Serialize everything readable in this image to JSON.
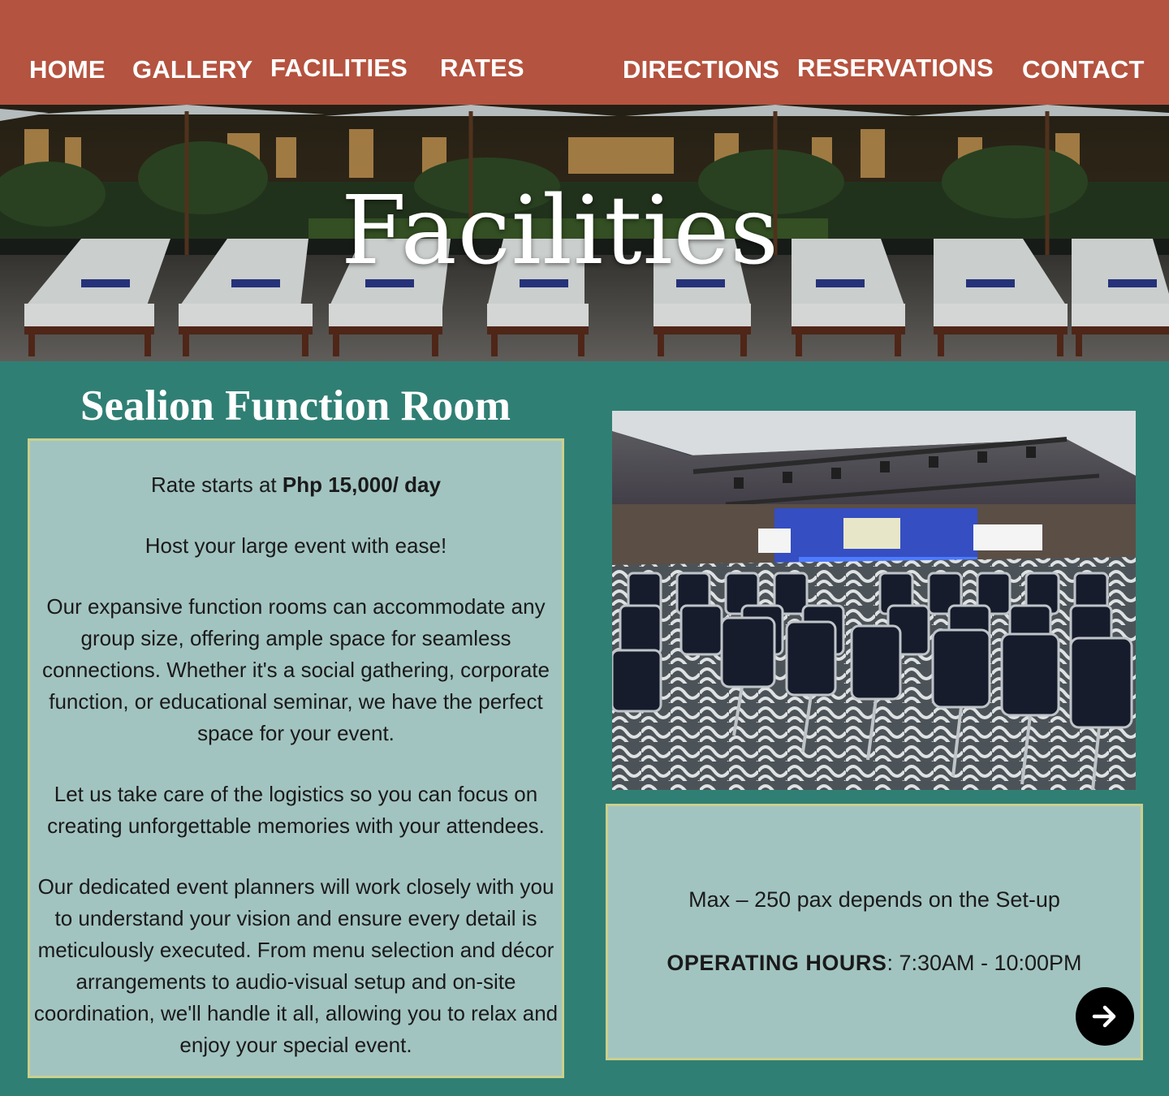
{
  "nav": {
    "items": [
      "HOME",
      "GALLERY",
      "FACILITIES",
      "RATES",
      "DIRECTIONS",
      "RESERVATIONS",
      "CONTACT"
    ]
  },
  "hero": {
    "title": "Facilities"
  },
  "room": {
    "title": "Sealion Function Room",
    "rate_prefix": "Rate starts at ",
    "rate_value": "Php 15,000/ day",
    "tagline": "Host your large event with ease!",
    "paragraph_1": "Our expansive function rooms can accommodate any group size, offering ample space for seamless connections. Whether it's a social gathering, corporate function, or educational seminar, we have the perfect space for your event.",
    "paragraph_2": "Let us take care of the logistics so you can focus on creating unforgettable memories with your attendees.",
    "paragraph_3": "Our dedicated event planners will work closely with you to understand your vision and ensure every detail is meticulously executed. From menu selection and décor arrangements to audio-visual setup and on-site coordination, we'll handle it all, allowing you to relax and enjoy your special event."
  },
  "info": {
    "capacity": "Max – 250 pax depends on the Set-up",
    "hours_label": "OPERATING HOURS",
    "hours_value": ": 7:30AM - 10:00PM"
  },
  "icons": {
    "next": "arrow-right-icon"
  },
  "colors": {
    "nav_bg": "#b4533f",
    "page_bg": "#307f74",
    "box_bg": "#a2c4c1",
    "box_border": "#c9d08d"
  }
}
